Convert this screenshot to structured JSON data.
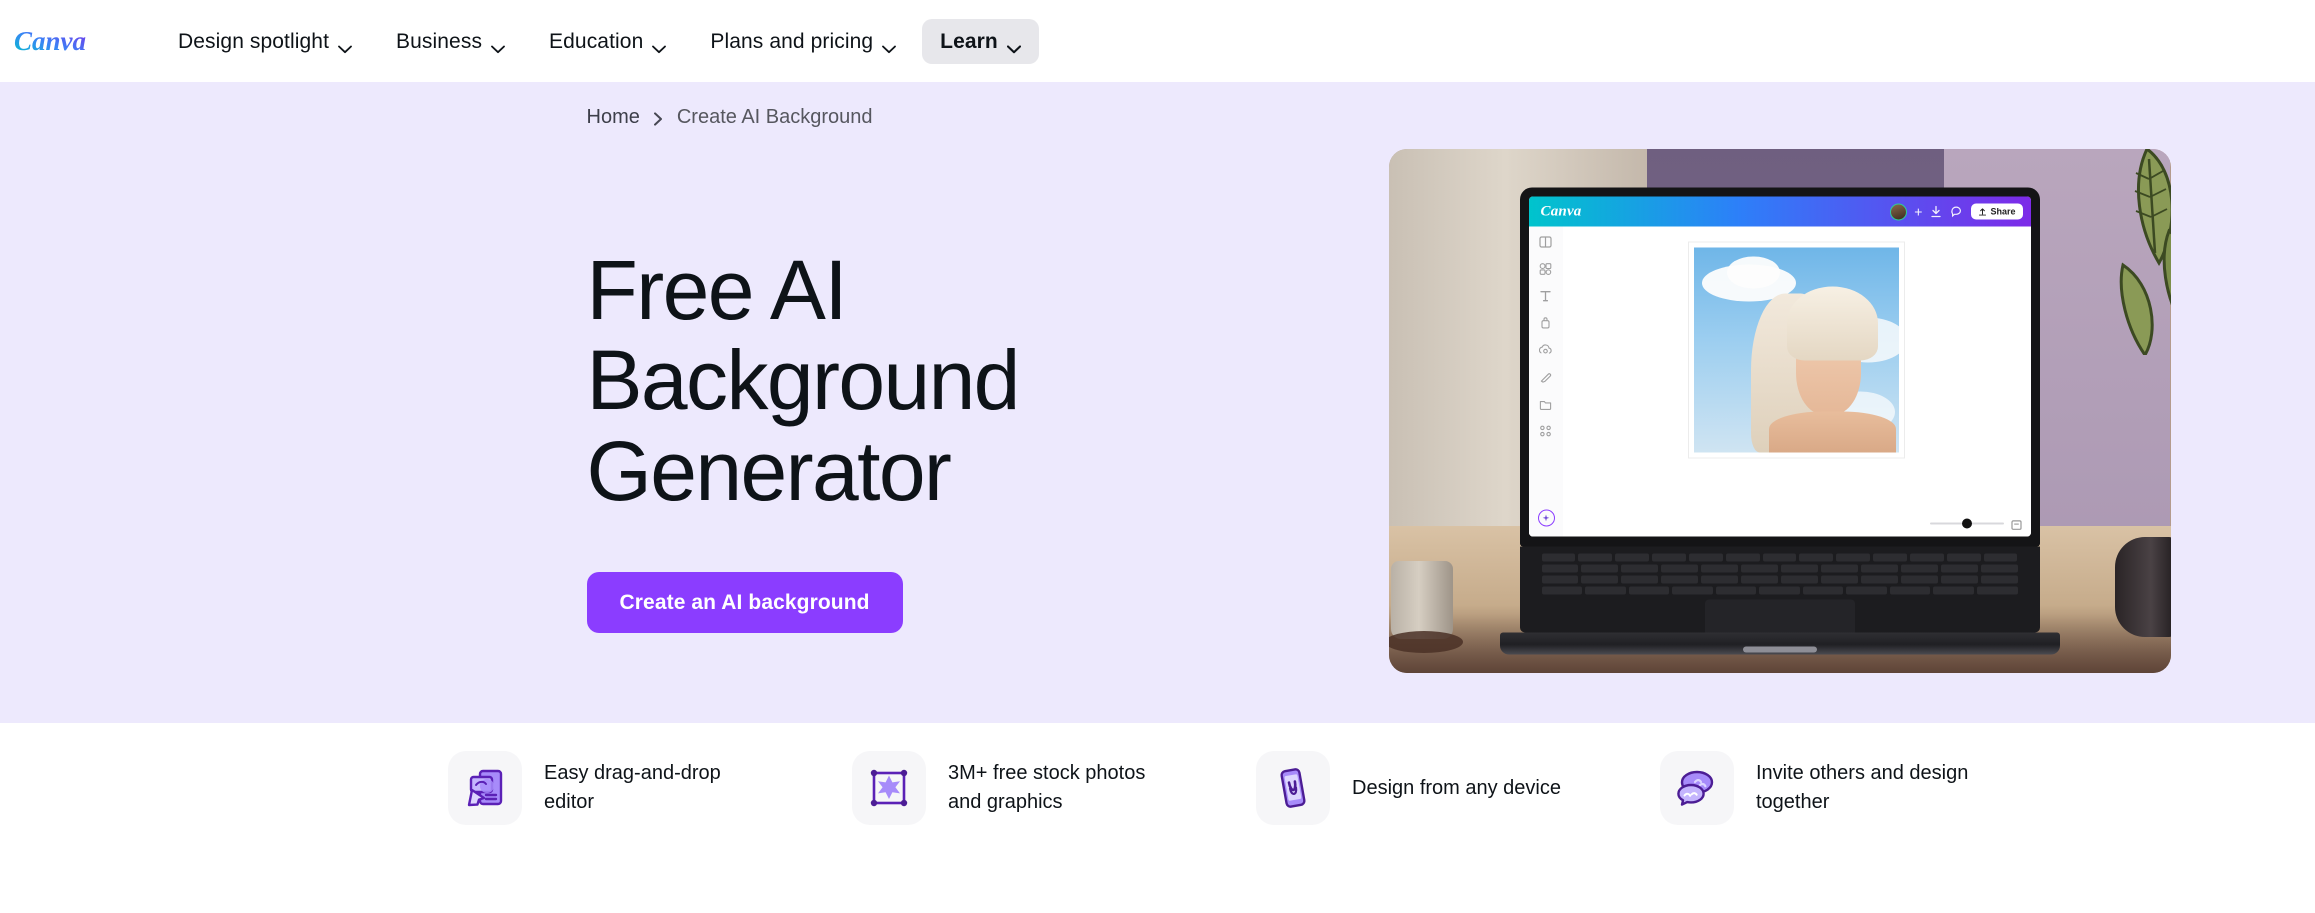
{
  "brand": {
    "logo_text": "Canva",
    "accent": "#8b3dff",
    "hero_bg": "#ede9fd"
  },
  "nav": {
    "items": [
      {
        "label": "Design spotlight",
        "has_chevron": true,
        "active": false,
        "icon": "chevron-down-icon"
      },
      {
        "label": "Business",
        "has_chevron": true,
        "active": false,
        "icon": "chevron-down-icon"
      },
      {
        "label": "Education",
        "has_chevron": true,
        "active": false,
        "icon": "chevron-down-icon"
      },
      {
        "label": "Plans and pricing",
        "has_chevron": true,
        "active": false,
        "icon": "chevron-down-icon"
      },
      {
        "label": "Learn",
        "has_chevron": true,
        "active": true,
        "icon": "chevron-down-icon"
      }
    ]
  },
  "breadcrumb": {
    "home": "Home",
    "separator_icon": "chevron-right-icon",
    "current": "Create AI Background"
  },
  "hero": {
    "title": "Free AI Background Generator",
    "cta_label": "Create an AI background",
    "image": {
      "alt_name": "laptop-canva-editor-photo",
      "editor": {
        "logo": "Canva",
        "share_label": "Share",
        "avatar_icon": "avatar-icon",
        "add_member_icon": "plus-icon",
        "undo_icon": "undo-icon",
        "comment_icon": "comment-icon",
        "share_icon": "share-icon",
        "magic_icon": "magic-wand-icon",
        "sidebar_icons": [
          "design-icon",
          "elements-icon",
          "text-icon",
          "brand-icon",
          "uploads-icon",
          "draw-icon",
          "projects-icon",
          "apps-icon"
        ],
        "zoom_slider_icon": "fit-page-icon"
      }
    }
  },
  "features": [
    {
      "label": "Easy drag-and-drop editor",
      "icon": "drag-drop-editor-icon"
    },
    {
      "label": "3M+ free stock photos and graphics",
      "icon": "stock-photos-icon"
    },
    {
      "label": "Design from any device",
      "icon": "mobile-device-icon"
    },
    {
      "label": "Invite others and design together",
      "icon": "collaborate-icon"
    }
  ]
}
